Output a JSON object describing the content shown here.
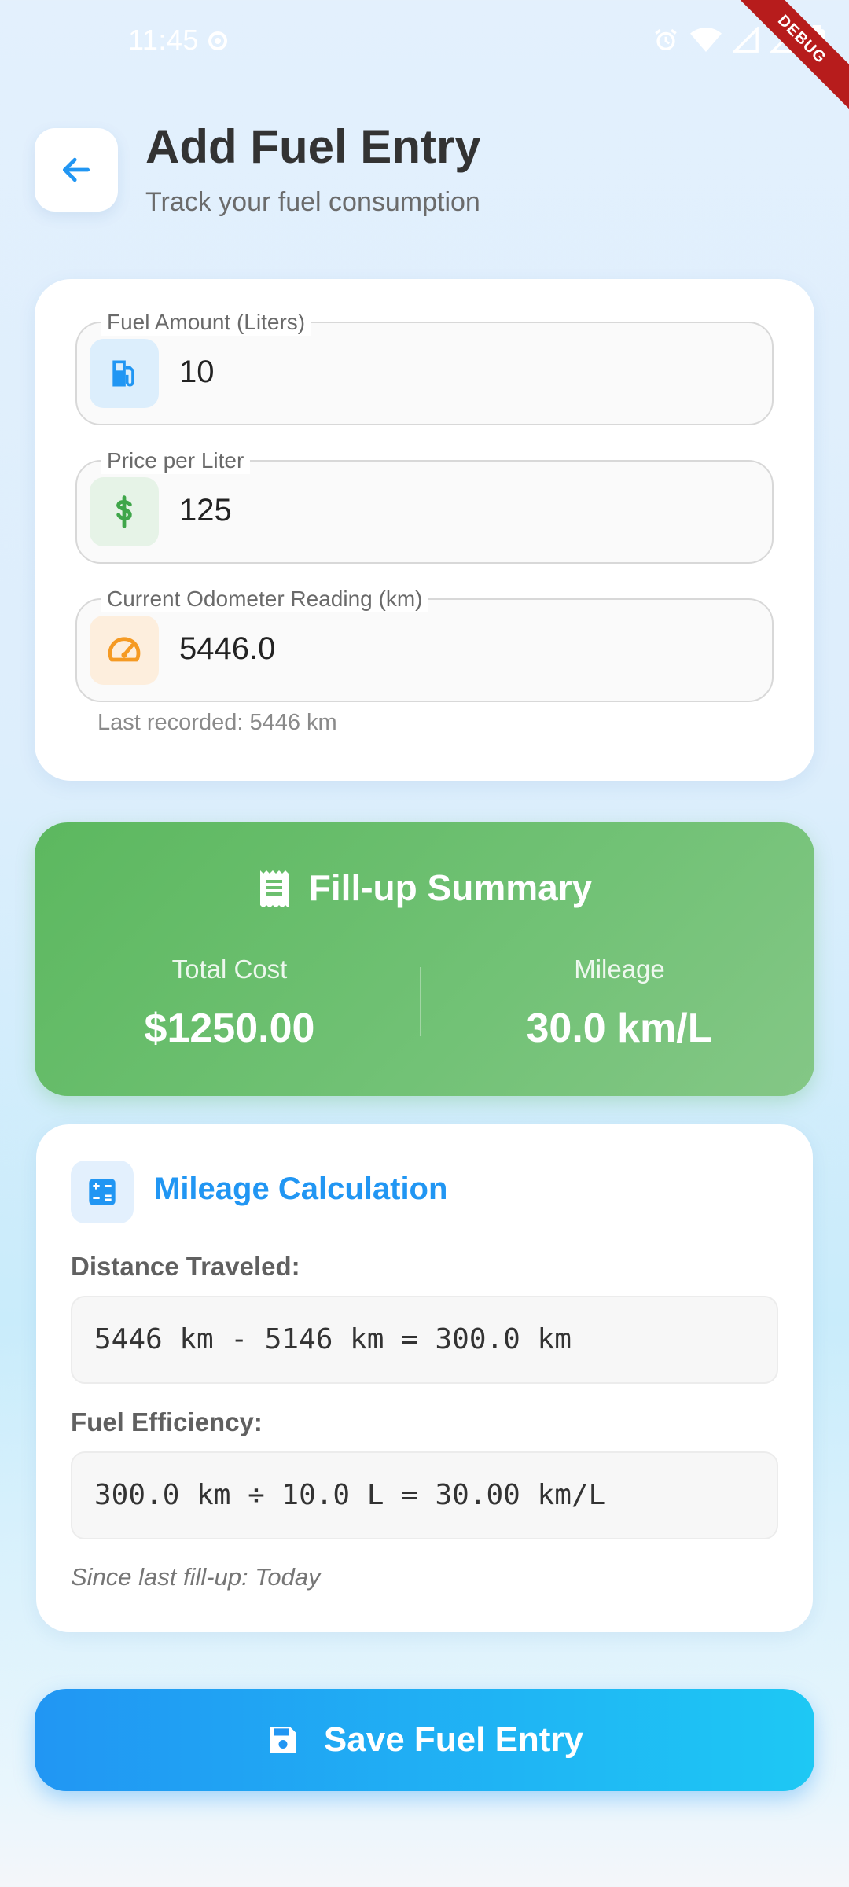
{
  "status_bar": {
    "time": "11:45"
  },
  "debug_banner": "DEBUG",
  "header": {
    "title": "Add Fuel Entry",
    "subtitle": "Track your fuel consumption"
  },
  "form": {
    "fuel_amount": {
      "label": "Fuel Amount (Liters)",
      "value": "10",
      "icon": "fuel-pump-icon"
    },
    "price_per_liter": {
      "label": "Price per Liter",
      "value": "125",
      "icon": "dollar-icon"
    },
    "odometer": {
      "label": "Current Odometer Reading (km)",
      "value": "5446.0",
      "icon": "speedometer-icon"
    },
    "helper": "Last recorded: 5446 km"
  },
  "summary": {
    "title": "Fill-up Summary",
    "icon": "receipt-icon",
    "total_cost_label": "Total Cost",
    "total_cost_value": "$1250.00",
    "mileage_label": "Mileage",
    "mileage_value": "30.0 km/L"
  },
  "calculation": {
    "title": "Mileage Calculation",
    "icon": "calculator-icon",
    "distance_label": "Distance Traveled:",
    "distance_formula": "5446 km - 5146 km = 300.0 km",
    "efficiency_label": "Fuel Efficiency:",
    "efficiency_formula": "300.0 km ÷ 10.0 L = 30.00 km/L",
    "note": "Since last fill-up: Today"
  },
  "actions": {
    "save_label": "Save Fuel Entry",
    "save_icon": "save-icon"
  },
  "colors": {
    "primary": "#2196f3",
    "success": "#4caf50",
    "warning": "#ff9800",
    "accent_cyan": "#1ec8f4"
  }
}
